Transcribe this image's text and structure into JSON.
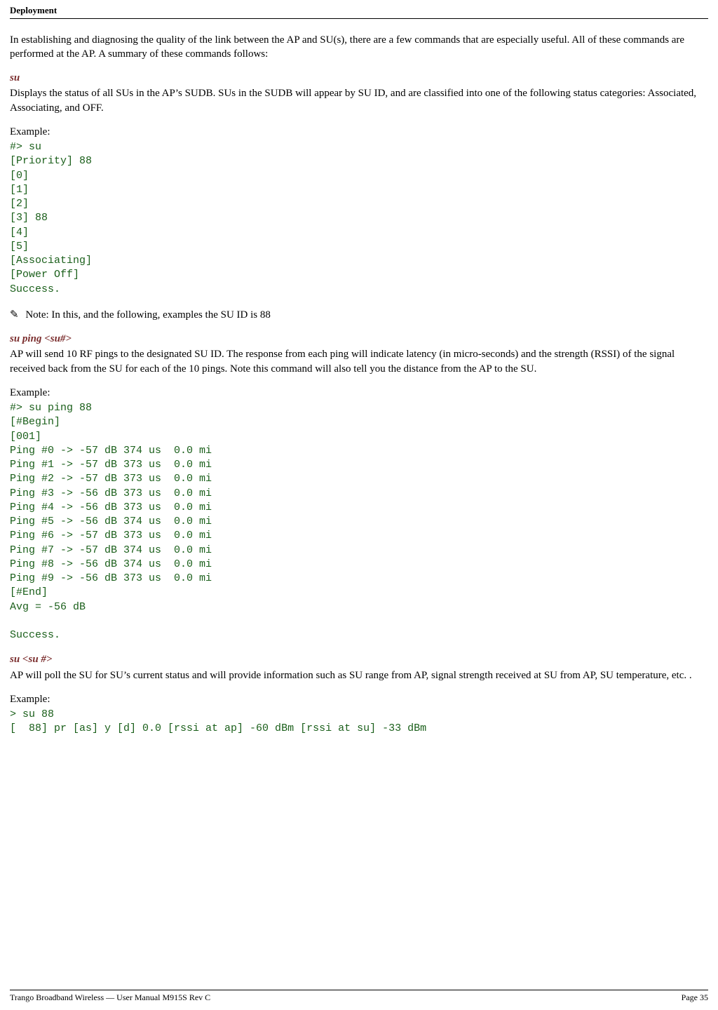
{
  "header": {
    "running_head": "Deployment"
  },
  "intro": {
    "text": "In establishing and diagnosing the quality of the link between the AP and SU(s), there are a few commands that are especially useful.  All of these commands are performed at the AP.  A summary of these commands follows:"
  },
  "cmd_su": {
    "name": "su",
    "desc": "Displays the status of all SUs in the AP’s SUDB.  SUs in the SUDB will appear by SU ID, and are classified into one of the following status categories:  Associated, Associating, and OFF.",
    "example_label": "Example:",
    "terminal": "#> su\n[Priority] 88\n[0]\n[1]\n[2]\n[3] 88\n[4]\n[5]\n[Associating]\n[Power Off]\nSuccess."
  },
  "note": {
    "icon": "✎",
    "text": "Note:  In this, and the following, examples the SU ID is 88"
  },
  "cmd_su_ping": {
    "name": "su ping <su#>",
    "desc": "AP will send 10 RF pings to the designated SU ID.  The response from each ping will indicate latency (in micro-seconds) and the strength (RSSI) of the signal received back from the SU for each of the 10 pings.  Note this command will also tell you the distance from the AP to the SU.",
    "example_label": "Example:",
    "terminal": "#> su ping 88\n[#Begin]\n[001]\nPing #0 -> -57 dB 374 us  0.0 mi\nPing #1 -> -57 dB 373 us  0.0 mi\nPing #2 -> -57 dB 373 us  0.0 mi\nPing #3 -> -56 dB 373 us  0.0 mi\nPing #4 -> -56 dB 373 us  0.0 mi\nPing #5 -> -56 dB 374 us  0.0 mi\nPing #6 -> -57 dB 373 us  0.0 mi\nPing #7 -> -57 dB 374 us  0.0 mi\nPing #8 -> -56 dB 374 us  0.0 mi\nPing #9 -> -56 dB 373 us  0.0 mi\n[#End]\nAvg = -56 dB\n\nSuccess."
  },
  "cmd_su_num": {
    "name": "su  <su #>",
    "desc": "AP will poll the SU for SU’s current status and will provide information such as SU range from AP, signal strength received at SU from AP, SU temperature, etc. .",
    "example_label": "Example:",
    "terminal": "> su 88\n[  88] pr [as] y [d] 0.0 [rssi at ap] -60 dBm [rssi at su] -33 dBm"
  },
  "footer": {
    "left": "Trango Broadband Wireless — User Manual M915S Rev C",
    "right": "Page 35"
  }
}
